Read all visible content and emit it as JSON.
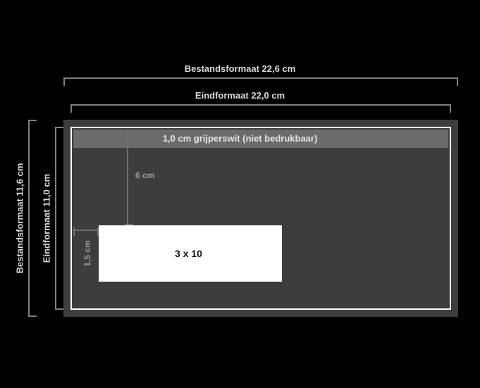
{
  "labels": {
    "file_format": "Bestandsformaat 22,6 cm",
    "trim_format": "Eindformaat 22,0 cm",
    "file_format_h": "Bestandsformaat 11,6 cm",
    "trim_format_h": "Eindformaat 11,0 cm",
    "gripper": "1,0 cm grijperswit (niet bedrukbaar)",
    "window": "3 x 10",
    "dim_top": "6 cm",
    "dim_left": "1,5 cm"
  }
}
